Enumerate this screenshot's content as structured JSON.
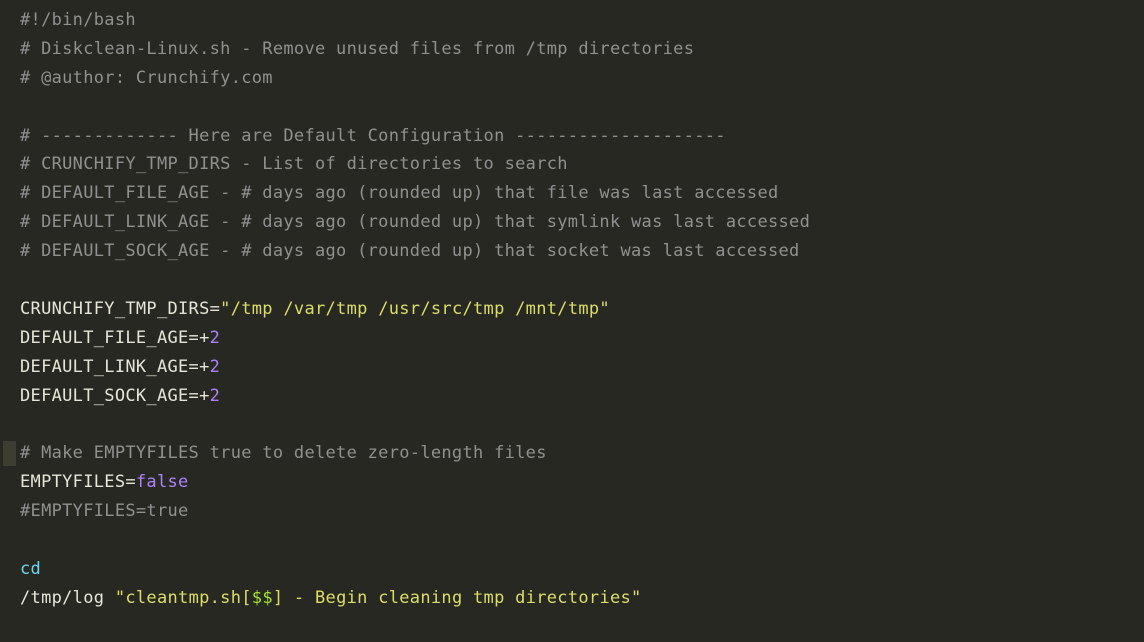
{
  "code": {
    "l1a": "#!",
    "l1b": "/bin/bash",
    "l2": "# Diskclean-Linux.sh - Remove unused files from /tmp directories",
    "l3": "# @author: Crunchify.com",
    "l5": "# ------------- Here are Default Configuration --------------------",
    "l6": "# CRUNCHIFY_TMP_DIRS - List of directories to search",
    "l7": "# DEFAULT_FILE_AGE - # days ago (rounded up) that file was last accessed",
    "l8": "# DEFAULT_LINK_AGE - # days ago (rounded up) that symlink was last accessed",
    "l9": "# DEFAULT_SOCK_AGE - # days ago (rounded up) that socket was last accessed",
    "l11a": "CRUNCHIFY_TMP_DIRS=",
    "l11b": "\"/tmp /var/tmp /usr/src/tmp /mnt/tmp\"",
    "l12a": "DEFAULT_FILE_AGE=+",
    "l12b": "2",
    "l13a": "DEFAULT_LINK_AGE=+",
    "l13b": "2",
    "l14a": "DEFAULT_SOCK_AGE=+",
    "l14b": "2",
    "l16": "# Make EMPTYFILES true to delete zero-length files",
    "l17a": "EMPTYFILES=",
    "l17b": "false",
    "l18": "#EMPTYFILES=true",
    "l20": "cd",
    "l21a": "/tmp/log ",
    "l21b": "\"cleantmp.sh[",
    "l21c": "$$",
    "l21d": "] - Begin cleaning tmp directories\""
  }
}
